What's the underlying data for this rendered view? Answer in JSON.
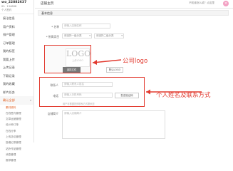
{
  "user": {
    "name": "wo_22882637",
    "id": "ID：134688",
    "sub": "个人签约"
  },
  "sidebar": {
    "items": [
      {
        "label": "接洽信息"
      },
      {
        "label": "用户资料"
      },
      {
        "label": "排产管理"
      },
      {
        "label": "订单管理"
      },
      {
        "label": "我的标签"
      },
      {
        "label": "我要上传"
      },
      {
        "label": "上传记录"
      },
      {
        "label": "下载记录"
      },
      {
        "label": "我的收藏"
      },
      {
        "label": "样片任务"
      },
      {
        "label": "确认全部"
      }
    ],
    "subs": [
      {
        "label": "素材资料"
      },
      {
        "label": "在线签约管理"
      },
      {
        "label": "文章运营管理"
      },
      {
        "label": "设计师订单"
      },
      {
        "label": "在线分享"
      },
      {
        "label": "上传协议管理"
      },
      {
        "label": "投稿记录管理"
      },
      {
        "label": "站外作品管理"
      },
      {
        "label": "消息管理"
      },
      {
        "label": "推荐管理"
      }
    ]
  },
  "topbar": {
    "title": "店铺主页",
    "hint": "不知道怎么填？点这里",
    "close": "×"
  },
  "section": {
    "title": "基本信息"
  },
  "form": {
    "name_label": "* 名称",
    "name_placeholder": "请输入店铺名称",
    "industry_label": "* 所属类目",
    "industry_sel1": "请选择一级分类",
    "industry_sel2": "请选择二级分类",
    "logo_label": "店铺logo",
    "logo_preview_big": "LOGO",
    "logo_preview_small": "上传LOGO",
    "upload_btn": "选择文件",
    "default_btn": "默认LOGO",
    "contact_label": "联系人",
    "contact_placeholder": "请输入联系人姓名",
    "phone_label": "电话",
    "phone_placeholder": "请输入手机号码",
    "verify_btn": "发送验证码",
    "phone_note": "用户可根据您的联系方式联系您",
    "desc_label": "店铺简介",
    "desc_placeholder": "请输入店铺简介"
  },
  "annotations": {
    "logo": "公司logo",
    "contact": "个人姓名及联系方式"
  }
}
